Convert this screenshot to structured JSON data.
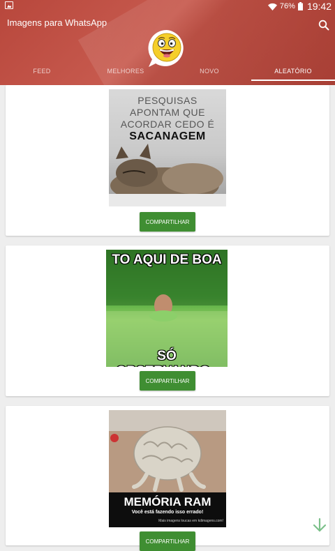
{
  "status": {
    "battery": "76%",
    "time": "19:42"
  },
  "app": {
    "title": "Imagens para WhatsApp"
  },
  "tabs": [
    {
      "label": "FEED"
    },
    {
      "label": "MELHORES"
    },
    {
      "label": "NOVO"
    },
    {
      "label": "ALEATÓRIO"
    }
  ],
  "active_tab": "ALEATÓRIO",
  "cards": [
    {
      "meme_lines": [
        "PESQUISAS",
        "APONTAM QUE",
        "ACORDAR CEDO É",
        "SACANAGEM"
      ],
      "share_label": "COMPARTILHAR"
    },
    {
      "meme_top": "TO AQUI DE BOA",
      "meme_bottom": "SÓ OBSERVANDO..",
      "share_label": "COMPARTILHAR"
    },
    {
      "meme_title": "MEMÓRIA RAM",
      "meme_sub": "Você está fazendo isso errado!",
      "meme_credit": "Mais imagens loucas em kdimagens.com!",
      "share_label": "COMPARTILHAR"
    }
  ],
  "colors": {
    "header": "#b8473c",
    "button": "#3f8e32",
    "fab_arrow": "#7cc08a"
  },
  "icons": [
    "gallery-icon",
    "wifi-icon",
    "battery-icon",
    "search-icon",
    "arrow-down-icon"
  ]
}
